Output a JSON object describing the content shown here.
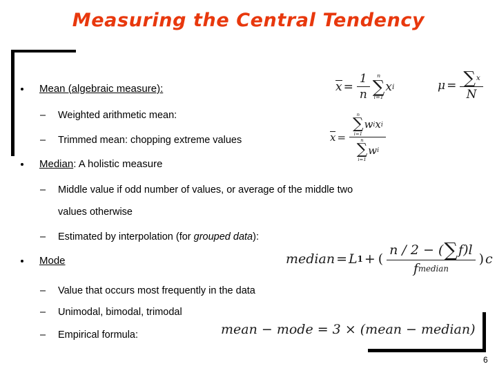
{
  "slide": {
    "title": "Measuring the Central Tendency",
    "title_color": "#e8380d",
    "number": "6",
    "background_color": "#ffffff"
  },
  "bullets": [
    {
      "level": 1,
      "name": "bullet-mean",
      "text_underlined": "Mean (algebraic measure):",
      "children": [
        {
          "level": 2,
          "name": "bullet-weighted-arithmetic-mean",
          "marker": "–",
          "text": "Weighted arithmetic mean:"
        },
        {
          "level": 2,
          "name": "bullet-trimmed-mean",
          "marker": "–",
          "text": "Trimmed mean: chopping extreme values"
        }
      ]
    },
    {
      "level": 1,
      "name": "bullet-median",
      "text_underlined": "Median",
      "text_rest": ": A holistic measure",
      "children": [
        {
          "level": 2,
          "name": "bullet-middle-value",
          "marker": "–",
          "text": "Middle value if odd number of values, or average of the middle two",
          "text_line2": "values otherwise"
        },
        {
          "level": 2,
          "name": "bullet-interpolation",
          "marker": "–",
          "text_before": "Estimated by interpolation (for ",
          "text_italic": "grouped data",
          "text_after": "):"
        }
      ]
    },
    {
      "level": 1,
      "name": "bullet-mode",
      "text_underlined": "Mode",
      "children": [
        {
          "level": 2,
          "name": "bullet-most-frequent",
          "marker": "–",
          "text": "Value that occurs most frequently in the data"
        },
        {
          "level": 2,
          "name": "bullet-modality",
          "marker": "–",
          "text": "Unimodal, bimodal, trimodal"
        },
        {
          "level": 2,
          "name": "bullet-empirical-formula",
          "marker": "–",
          "text": "Empirical formula:"
        }
      ]
    }
  ],
  "equations": {
    "sample_mean": {
      "name": "sample-mean-formula",
      "lhs": "x",
      "eq": "=",
      "frac_num": "1",
      "frac_den": "n",
      "sigma_upper": "n",
      "sigma_lower": "i=1",
      "sigma_glyph": "∑",
      "term": "x",
      "term_sub": "i"
    },
    "population_mean": {
      "name": "population-mean-formula",
      "lhs": "μ",
      "eq": "=",
      "sigma_glyph": "∑",
      "num_term": "x",
      "den": "N"
    },
    "weighted_mean": {
      "name": "weighted-mean-formula",
      "lhs": "x",
      "eq": "=",
      "sigma_glyph": "∑",
      "num_upper": "n",
      "num_lower": "i=1",
      "num_term_w": "w",
      "num_term_w_sub": "i",
      "num_term_x": "x",
      "num_term_x_sub": "i",
      "den_upper": "n",
      "den_lower": "i=1",
      "den_term_w": "w",
      "den_term_w_sub": "i"
    },
    "median_interpolation": {
      "name": "median-interpolation-formula",
      "lhs": "median",
      "eq": "=",
      "l_term": "L",
      "l_sub": "1",
      "plus": "+",
      "open_paren": "(",
      "num_prefix": "n / 2 − (",
      "num_sigma": "∑",
      "num_f": "f",
      "num_suffix": ")l",
      "den_f": "f",
      "den_sub": "median",
      "close_paren": ")",
      "tail": "c"
    },
    "empirical": {
      "name": "empirical-formula",
      "text": "mean − mode = 3 × (mean − median)"
    }
  }
}
